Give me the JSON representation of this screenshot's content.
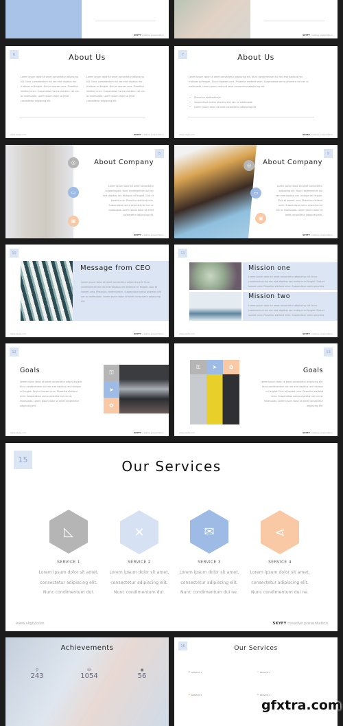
{
  "lorem_short": "Lorem ipsum dolor sit amet consectetur adipiscing elit. Nunc condimentum dui nec erat dapibus nec tristique mi feugiat. Duis et laoreet urna. Phasellus eleifend enim. Suspendisse varius pharetra nisl nec ac malesuada. Lorem ipsum dolor sit amet consectetur adipiscing elit.",
  "footer": {
    "url": "www.skyfy.com",
    "brand": "SKYFY",
    "tagline": "creative presentation"
  },
  "slides": {
    "s6": {
      "num": "6",
      "title": "About Us"
    },
    "s7": {
      "num": "7",
      "title": "About Us",
      "bullets": [
        "Phasellus eleifend enim",
        "Suspendisse varius pharetra nisl nec ac malesuada",
        "Lorem ipsum dolor sit amet consectetur adipiscing elit"
      ]
    },
    "s8": {
      "num": "8",
      "title": "About Company"
    },
    "s9": {
      "num": "9",
      "title": "About Company"
    },
    "s10": {
      "num": "10",
      "title": "Message from CEO"
    },
    "s11": {
      "num": "11",
      "title1": "Mission one",
      "title2": "Mission two"
    },
    "s12": {
      "num": "12",
      "title": "Goals"
    },
    "s13": {
      "num": "13",
      "title": "Goals"
    },
    "s15": {
      "num": "15",
      "title": "Our Services",
      "services": [
        {
          "label": "SERVICE 1",
          "lines": [
            "Lorem ipsum dolor sit amet,",
            "consectetur adipiscing elit.",
            "Nunc condimentum dui."
          ],
          "color": "#b5b5b5",
          "icon": "ruler-triangle-icon"
        },
        {
          "label": "SERVICE 2",
          "lines": [
            "Lorem ipsum dolor sit amet,",
            "consectetur adipiscing elit.",
            "Nunc condimentum dui."
          ],
          "color": "#d6e2f3",
          "icon": "tools-icon"
        },
        {
          "label": "SERVICE 3",
          "lines": [
            "Lorem ipsum dolor sit amet,",
            "consectetur adipiscing elit.",
            "Nunc condimentum dui ne."
          ],
          "color": "#9dbbe4",
          "icon": "envelope-open-icon"
        },
        {
          "label": "SERVICE 4",
          "lines": [
            "Lorem ipsum dolor sit amet,",
            "consectetur adipiscing elit.",
            "Nunc condimentum dui ne."
          ],
          "color": "#f9c8a5",
          "icon": "share-icon"
        }
      ]
    },
    "achievements": {
      "title": "Achievements",
      "stats": [
        {
          "value": "243",
          "icon": "map-pin-icon"
        },
        {
          "value": "1054",
          "icon": "database-icon"
        },
        {
          "value": "56",
          "icon": "eye-icon"
        }
      ]
    },
    "s16": {
      "num": "16",
      "title": "Our Services",
      "items": [
        "SERVICE 1",
        "SERVICE 2",
        "SERVICE 3",
        "SERVICE 4"
      ]
    }
  },
  "colors": {
    "background": "#1c1c1c",
    "blue": "#9dbbe4",
    "light_blue": "#dbe5f3",
    "peach": "#f9c8a5",
    "gray": "#b5b5b5"
  },
  "watermark": "gfxtra.com"
}
